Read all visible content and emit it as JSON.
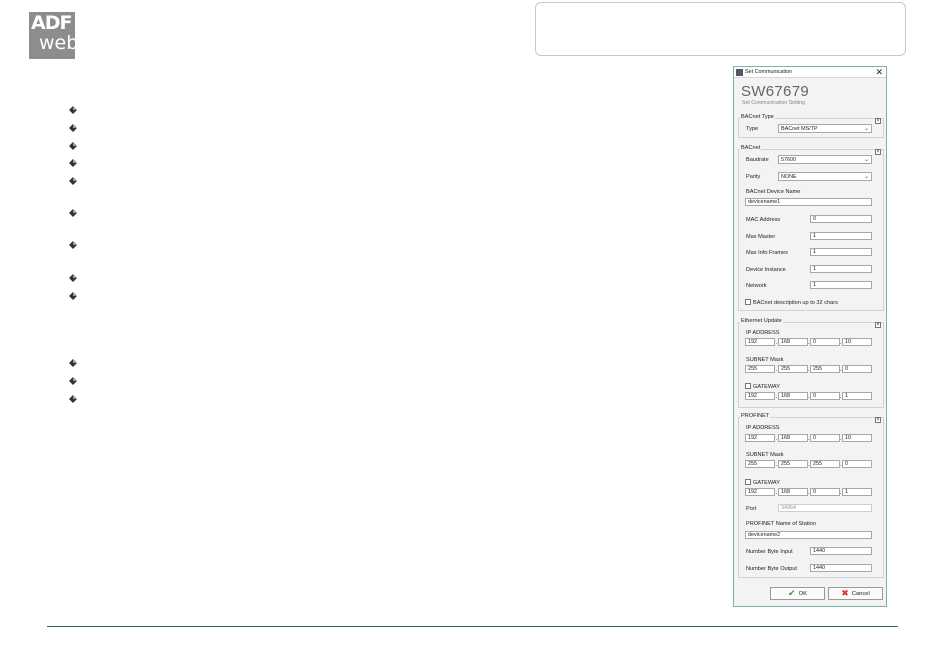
{
  "logo": {
    "line1": "ADF",
    "line2": "web"
  },
  "bullets": [
    110,
    128,
    146,
    163,
    181,
    213,
    245,
    278,
    296,
    363,
    381,
    399
  ],
  "dialog": {
    "title": "Set Communication",
    "close": "✕",
    "product": "SW67679",
    "subtitle": "Set Communication Setting",
    "bacnet_type": {
      "group": "BACnet Type",
      "type_label": "Type",
      "type_value": "BACnet MS/TP"
    },
    "bacnet": {
      "group": "BACnet",
      "baudrate_label": "Baudrate",
      "baudrate_value": "57600",
      "parity_label": "Parity",
      "parity_value": "NONE",
      "device_name_label": "BACnet Device Name",
      "device_name_value": "devicename1",
      "mac_label": "MAC Address",
      "mac_value": "0",
      "max_master_label": "Max Master",
      "max_master_value": "1",
      "max_info_label": "Max Info Frames",
      "max_info_value": "1",
      "device_instance_label": "Device Instance",
      "device_instance_value": "1",
      "network_label": "Network",
      "network_value": "1",
      "desc_check_label": "BACnet description up to 32 chars"
    },
    "ethernet": {
      "group": "Ethernet Update",
      "ip_label": "IP ADDRESS",
      "ip": [
        "192",
        "168",
        "0",
        "10"
      ],
      "mask_label": "SUBNET Mask",
      "mask": [
        "255",
        "255",
        "255",
        "0"
      ],
      "gateway_label": "GATEWAY",
      "gateway": [
        "192",
        "168",
        "0",
        "1"
      ]
    },
    "profinet": {
      "group": "PROFINET",
      "ip_label": "IP ADDRESS",
      "ip": [
        "192",
        "168",
        "0",
        "10"
      ],
      "mask_label": "SUBNET Mask",
      "mask": [
        "255",
        "255",
        "255",
        "0"
      ],
      "gateway_label": "GATEWAY",
      "gateway": [
        "192",
        "168",
        "0",
        "1"
      ],
      "port_label": "Port",
      "port_value": "34964",
      "station_label": "PROFINET Name of Station",
      "station_value": "devicename2",
      "byte_input_label": "Number Byte Input",
      "byte_input_value": "1440",
      "byte_output_label": "Number Byte Output",
      "byte_output_value": "1440"
    },
    "ok_label": "OK",
    "cancel_label": "Cancel"
  }
}
